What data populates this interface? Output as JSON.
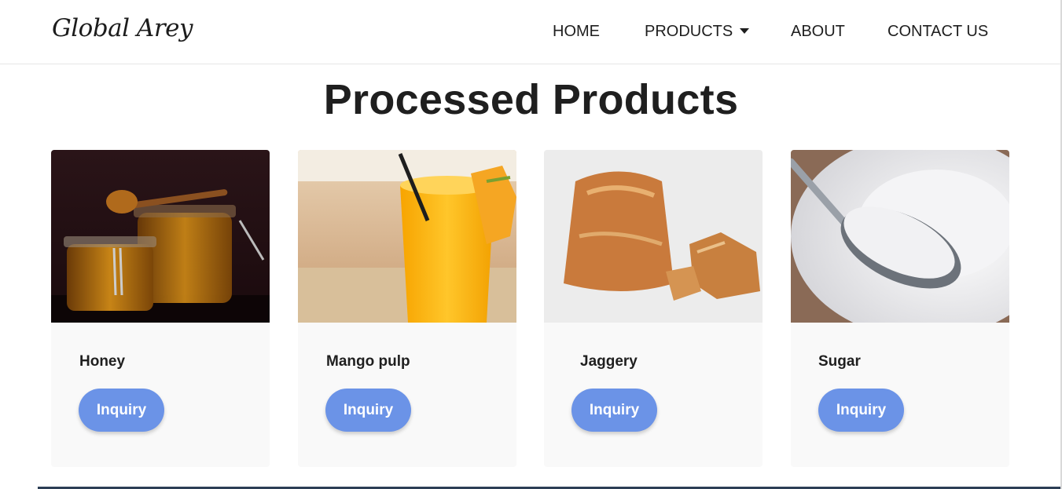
{
  "header": {
    "logo": "Global Arey",
    "nav": {
      "home": "HOME",
      "products": "PRODUCTS",
      "about": "ABOUT",
      "contact": "CONTACT US"
    }
  },
  "main": {
    "title": "Processed Products",
    "cards": [
      {
        "name": "Honey",
        "button": "Inquiry"
      },
      {
        "name": "Mango pulp",
        "button": "Inquiry"
      },
      {
        "name": "Jaggery",
        "button": "Inquiry"
      },
      {
        "name": "Sugar",
        "button": "Inquiry"
      }
    ]
  },
  "colors": {
    "button": "#6b93e7",
    "card_bg": "#f9f9f9",
    "text": "#1f1f1f"
  },
  "icons": {
    "products_caret": "caret-down-icon"
  }
}
